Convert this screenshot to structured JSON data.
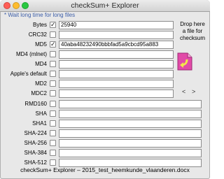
{
  "window": {
    "title": "checkSum+ Explorer",
    "status_line": "checkSum+ Explorer – 2015_test_heemkunde_vlaanderen.docx"
  },
  "note": "* Wait long time for long files",
  "drop_zone": {
    "text_line1": "Drop here",
    "text_line2": "a file for",
    "text_line3": "checksum",
    "icon": "document-drop-icon"
  },
  "nav": {
    "prev": "<",
    "next": ">"
  },
  "rows": [
    {
      "label": "Bytes",
      "checked": true,
      "value": "25940"
    },
    {
      "label": "CRC32",
      "checked": false,
      "value": ""
    },
    {
      "label": "MD5",
      "checked": true,
      "value": "40aba48232490bbbfad5a9cbcd95a883"
    },
    {
      "label": "MD4 (mlnet)",
      "checked": false,
      "value": ""
    },
    {
      "label": "MD4",
      "checked": false,
      "value": ""
    },
    {
      "label": "Apple's default",
      "checked": false,
      "value": ""
    },
    {
      "label": "MD2",
      "checked": false,
      "value": ""
    },
    {
      "label": "MDC2",
      "checked": false,
      "value": ""
    },
    {
      "label": "RMD160",
      "checked": false,
      "value": ""
    },
    {
      "label": "SHA",
      "checked": false,
      "value": ""
    },
    {
      "label": "SHA1",
      "checked": false,
      "value": ""
    },
    {
      "label": "SHA-224",
      "checked": false,
      "value": ""
    },
    {
      "label": "SHA-256",
      "checked": false,
      "value": ""
    },
    {
      "label": "SHA-384",
      "checked": false,
      "value": ""
    },
    {
      "label": "SHA-512",
      "checked": false,
      "value": ""
    }
  ],
  "checkmark_glyph": "✓"
}
